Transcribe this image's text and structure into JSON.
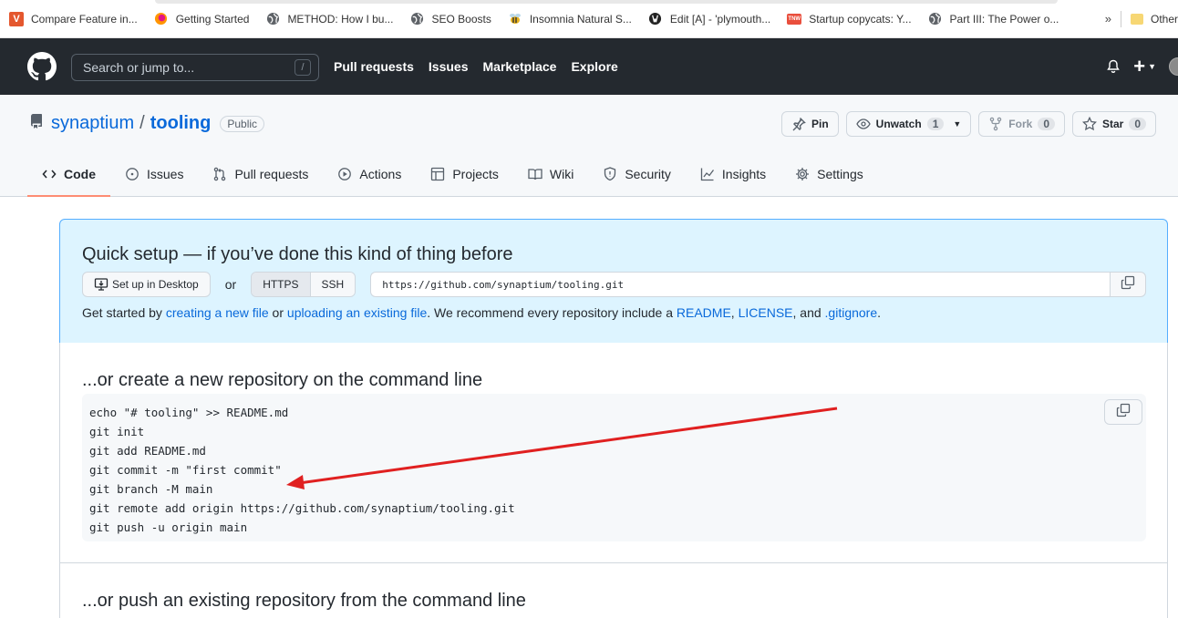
{
  "bookmarks": [
    {
      "label": "Compare Feature in...",
      "icon": "v-logo-icon",
      "color": "#e4572e",
      "glyph": "V"
    },
    {
      "label": "Getting Started",
      "icon": "firefox-icon",
      "color": "#e66000",
      "glyph": ""
    },
    {
      "label": "METHOD: How I bu...",
      "icon": "globe-icon",
      "color": "#5f6368",
      "glyph": ""
    },
    {
      "label": "SEO Boosts",
      "icon": "globe-icon",
      "color": "#5f6368",
      "glyph": ""
    },
    {
      "label": "Insomnia Natural S...",
      "icon": "bee-icon",
      "color": "#d4a017",
      "glyph": ""
    },
    {
      "label": "Edit [A] - 'plymouth...",
      "icon": "wordpress-icon",
      "color": "#222222",
      "glyph": ""
    },
    {
      "label": "Startup copycats: Y...",
      "icon": "tnw-icon",
      "color": "#e94e3c",
      "glyph": "TNW"
    },
    {
      "label": "Part III: The Power o...",
      "icon": "globe-icon",
      "color": "#5f6368",
      "glyph": ""
    }
  ],
  "bookmarks_overflow": "»",
  "other_bookmarks": "Other",
  "header": {
    "search_placeholder": "Search or jump to...",
    "search_key": "/",
    "nav": [
      "Pull requests",
      "Issues",
      "Marketplace",
      "Explore"
    ]
  },
  "repo": {
    "owner": "synaptium",
    "separator": "/",
    "name": "tooling",
    "visibility": "Public",
    "actions": {
      "pin": "Pin",
      "unwatch": "Unwatch",
      "watch_count": "1",
      "fork": "Fork",
      "fork_count": "0",
      "star": "Star",
      "star_count": "0"
    },
    "tabs": [
      "Code",
      "Issues",
      "Pull requests",
      "Actions",
      "Projects",
      "Wiki",
      "Security",
      "Insights",
      "Settings"
    ]
  },
  "quick_setup": {
    "title": "Quick setup — if you’ve done this kind of thing before",
    "desktop_button": "Set up in Desktop",
    "or": "or",
    "https": "HTTPS",
    "ssh": "SSH",
    "clone_url": "https://github.com/synaptium/tooling.git",
    "help": {
      "t1": "Get started by ",
      "l1": "creating a new file",
      "t2": " or ",
      "l2": "uploading an existing file",
      "t3": ". We recommend every repository include a ",
      "l3": "README",
      "t4": ", ",
      "l4": "LICENSE",
      "t5": ", and ",
      "l5": ".gitignore",
      "t6": "."
    }
  },
  "command_line": {
    "title": "...or create a new repository on the command line",
    "lines": [
      "echo \"# tooling\" >> README.md",
      "git init",
      "git add README.md",
      "git commit -m \"first commit\"",
      "git branch -M main",
      "git remote add origin https://github.com/synaptium/tooling.git",
      "git push -u origin main"
    ]
  },
  "push_existing": {
    "title": "...or push an existing repository from the command line"
  },
  "annotation": {
    "color": "#e02020"
  }
}
